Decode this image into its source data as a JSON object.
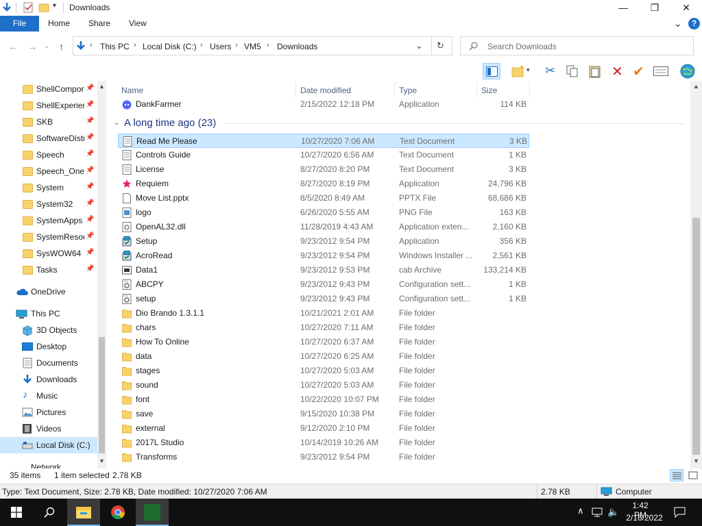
{
  "window": {
    "title": "Downloads",
    "minimize_glyph": "—",
    "maximize_glyph": "❐",
    "close_glyph": "✕"
  },
  "ribbon": {
    "tabs": [
      "File",
      "Home",
      "Share",
      "View"
    ],
    "help_glyph": "?",
    "expand_glyph": "⌄"
  },
  "address": {
    "breadcrumbs": [
      "This PC",
      "Local Disk (C:)",
      "Users",
      "VM5",
      "Downloads"
    ],
    "search_placeholder": "Search Downloads"
  },
  "nav": {
    "quick_access": [
      "ShellCompon",
      "ShellExperien",
      "SKB",
      "SoftwareDistr",
      "Speech",
      "Speech_OneC",
      "System",
      "System32",
      "SystemApps",
      "SystemResou",
      "SysWOW64",
      "Tasks"
    ],
    "onedrive": "OneDrive",
    "this_pc": "This PC",
    "pc_items": [
      "3D Objects",
      "Desktop",
      "Documents",
      "Downloads",
      "Music",
      "Pictures",
      "Videos",
      "Local Disk (C:)"
    ],
    "network": "Network"
  },
  "columns": {
    "name": "Name",
    "date": "Date modified",
    "type": "Type",
    "size": "Size"
  },
  "top_file": {
    "name": "DankFarmer",
    "date": "2/15/2022 12:18 PM",
    "type": "Application",
    "size": "114 KB"
  },
  "group": {
    "label": "A long time ago (23)"
  },
  "files": [
    {
      "name": "Read Me Please",
      "date": "10/27/2020 7:06 AM",
      "type": "Text Document",
      "size": "3 KB",
      "icon": "text-file",
      "selected": true
    },
    {
      "name": "Controls Guide",
      "date": "10/27/2020 6:56 AM",
      "type": "Text Document",
      "size": "1 KB",
      "icon": "text-file"
    },
    {
      "name": "License",
      "date": "8/27/2020 8:20 PM",
      "type": "Text Document",
      "size": "3 KB",
      "icon": "text-file"
    },
    {
      "name": "Requiem",
      "date": "8/27/2020 8:19 PM",
      "type": "Application",
      "size": "24,796 KB",
      "icon": "star-app"
    },
    {
      "name": "Move List.pptx",
      "date": "8/5/2020 8:49 AM",
      "type": "PPTX File",
      "size": "68,686 KB",
      "icon": "blank-file"
    },
    {
      "name": "logo",
      "date": "6/26/2020 5:55 AM",
      "type": "PNG File",
      "size": "163 KB",
      "icon": "image-file"
    },
    {
      "name": "OpenAL32.dll",
      "date": "11/28/2019 4:43 AM",
      "type": "Application exten...",
      "size": "2,160 KB",
      "icon": "dll-file"
    },
    {
      "name": "Setup",
      "date": "9/23/2012 9:54 PM",
      "type": "Application",
      "size": "356 KB",
      "icon": "installer"
    },
    {
      "name": "AcroRead",
      "date": "9/23/2012 9:54 PM",
      "type": "Windows Installer ...",
      "size": "2,561 KB",
      "icon": "installer"
    },
    {
      "name": "Data1",
      "date": "9/23/2012 9:53 PM",
      "type": "cab Archive",
      "size": "133,214 KB",
      "icon": "cab-file"
    },
    {
      "name": "ABCPY",
      "date": "9/23/2012 9:43 PM",
      "type": "Configuration sett...",
      "size": "1 KB",
      "icon": "config-file"
    },
    {
      "name": "setup",
      "date": "9/23/2012 9:43 PM",
      "type": "Configuration sett...",
      "size": "1 KB",
      "icon": "config-file"
    },
    {
      "name": "Dio Brando 1.3.1.1",
      "date": "10/21/2021 2:01 AM",
      "type": "File folder",
      "size": "",
      "icon": "folder"
    },
    {
      "name": "chars",
      "date": "10/27/2020 7:11 AM",
      "type": "File folder",
      "size": "",
      "icon": "folder"
    },
    {
      "name": "How To Online",
      "date": "10/27/2020 6:37 AM",
      "type": "File folder",
      "size": "",
      "icon": "folder"
    },
    {
      "name": "data",
      "date": "10/27/2020 6:25 AM",
      "type": "File folder",
      "size": "",
      "icon": "folder"
    },
    {
      "name": "stages",
      "date": "10/27/2020 5:03 AM",
      "type": "File folder",
      "size": "",
      "icon": "folder"
    },
    {
      "name": "sound",
      "date": "10/27/2020 5:03 AM",
      "type": "File folder",
      "size": "",
      "icon": "folder"
    },
    {
      "name": "font",
      "date": "10/22/2020 10:07 PM",
      "type": "File folder",
      "size": "",
      "icon": "folder"
    },
    {
      "name": "save",
      "date": "9/15/2020 10:38 PM",
      "type": "File folder",
      "size": "",
      "icon": "folder"
    },
    {
      "name": "external",
      "date": "9/12/2020 2:10 PM",
      "type": "File folder",
      "size": "",
      "icon": "folder"
    },
    {
      "name": "2017L Studio",
      "date": "10/14/2019 10:26 AM",
      "type": "File folder",
      "size": "",
      "icon": "folder"
    },
    {
      "name": "Transforms",
      "date": "9/23/2012 9:54 PM",
      "type": "File folder",
      "size": "",
      "icon": "folder"
    }
  ],
  "status": {
    "item_count": "35 items",
    "selected": "1 item selected",
    "selected_size": "2.78 KB"
  },
  "details": {
    "text": "Type: Text Document, Size: 2.78 KB, Date modified: 10/27/2020 7:06 AM",
    "size": "2.78 KB",
    "location": "Computer"
  },
  "taskbar": {
    "time": "1:42 PM",
    "date": "2/16/2022"
  },
  "colors": {
    "accent": "#1e6fc8",
    "selection_bg": "#cce8ff",
    "selection_border": "#99d1ff",
    "group_header": "#1e3287",
    "folder": "#f8d36a"
  }
}
